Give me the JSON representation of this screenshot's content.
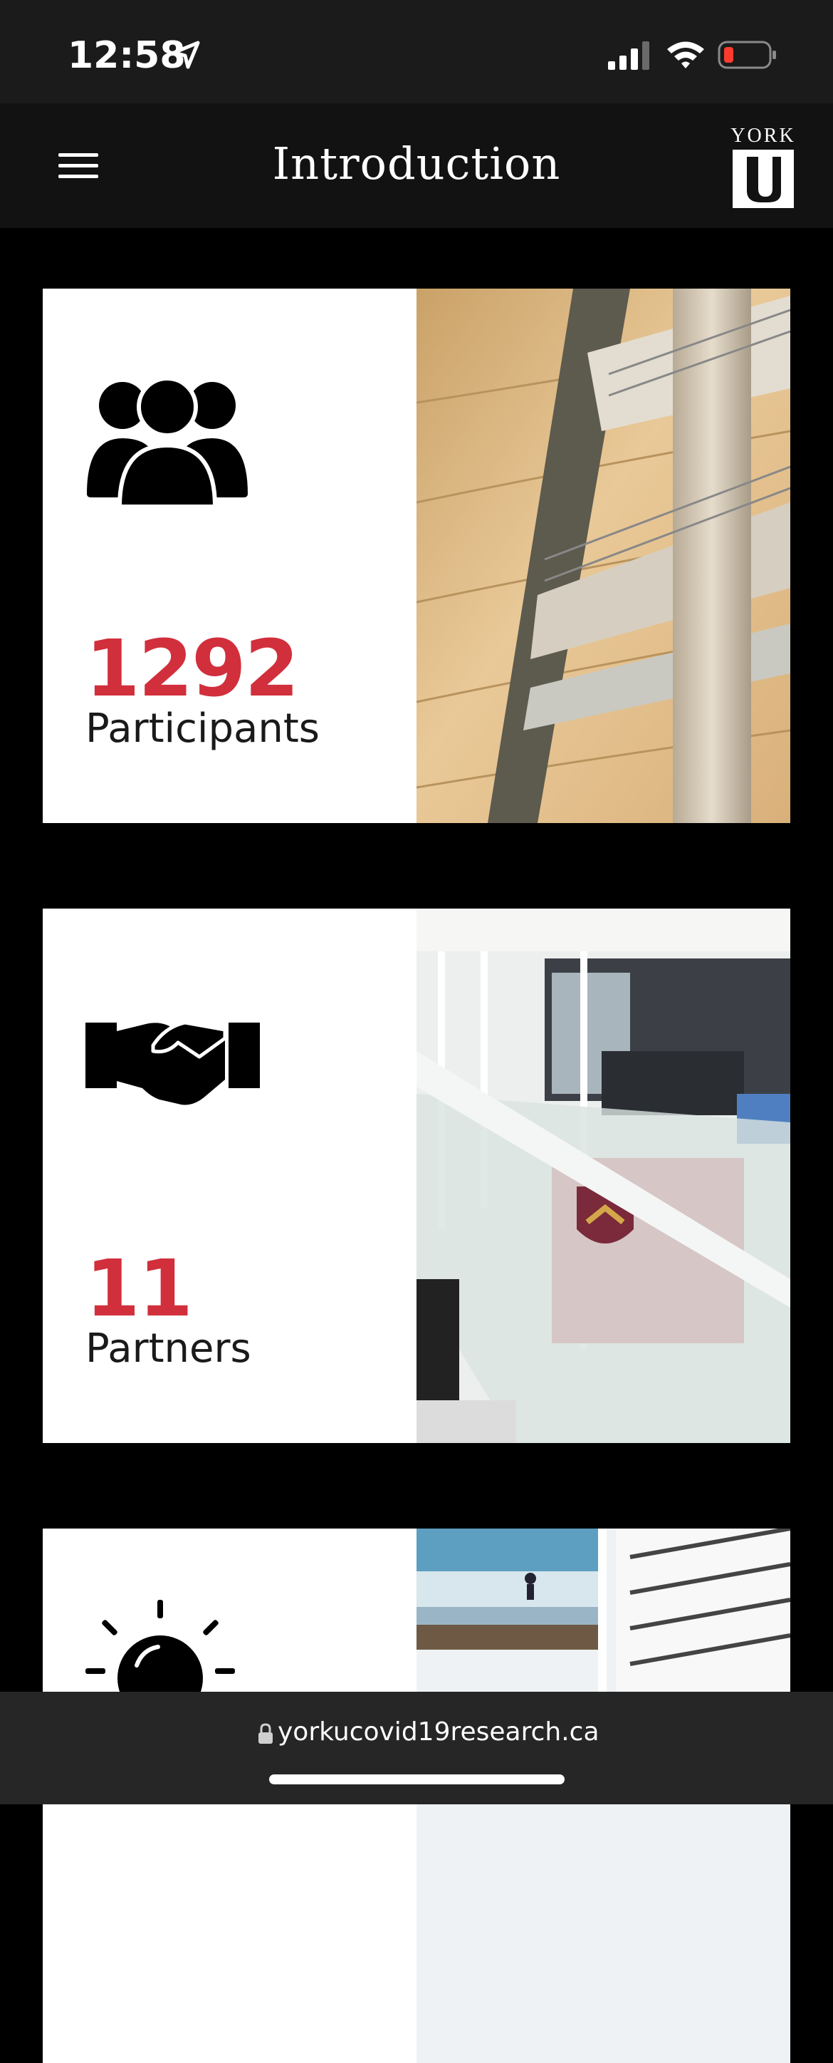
{
  "status_bar": {
    "time": "12:58",
    "icons": [
      "location-arrow-icon",
      "cellular-signal-icon",
      "wifi-icon",
      "battery-low-icon"
    ]
  },
  "nav": {
    "title": "Introduction",
    "menu_icon": "hamburger-menu-icon",
    "logo_text": "YORK",
    "logo_letter": "U"
  },
  "cards": [
    {
      "icon": "group-people-icon",
      "value": "1292",
      "label": "Participants",
      "photo": "curved-atrium-balconies-photo"
    },
    {
      "icon": "handshake-icon",
      "value": "11",
      "label": "Partners",
      "photo": "glass-railing-hallway-photo"
    },
    {
      "icon": "lightbulb-idea-icon",
      "value": "",
      "label": "",
      "photo": "white-atrium-levels-photo"
    }
  ],
  "browser": {
    "url": "yorkucovid19research.ca",
    "lock_icon": "lock-icon"
  },
  "colors": {
    "accent": "#d12f3c",
    "background": "#000000",
    "nav_background": "#121212",
    "card_background": "#ffffff"
  }
}
